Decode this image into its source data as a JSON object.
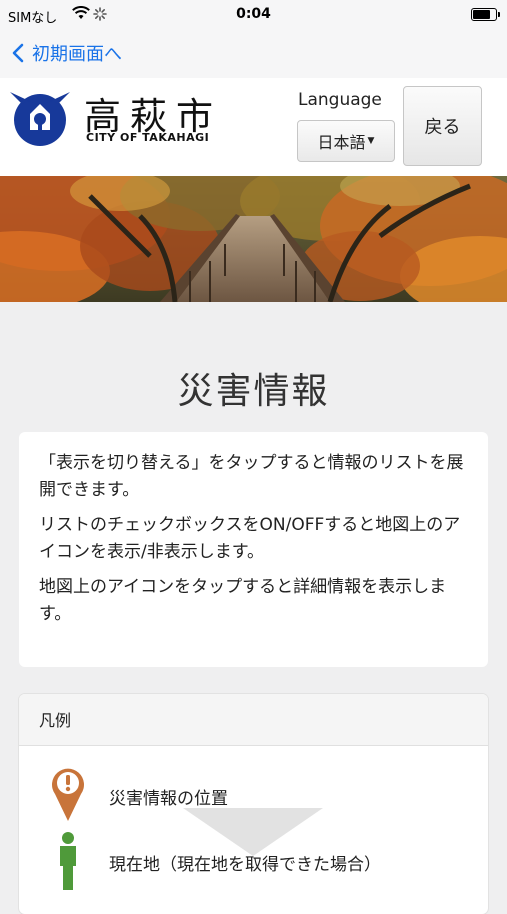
{
  "status_bar": {
    "carrier": "SIMなし",
    "time": "0:04"
  },
  "nav": {
    "back_label": "初期画面へ"
  },
  "header": {
    "logo_jp": "高萩市",
    "logo_en": "CITY OF TAKAHAGI",
    "language_label": "Language",
    "language_value": "日本語",
    "return_label": "戻る"
  },
  "main": {
    "title": "災害情報",
    "instructions": [
      "「表示を切り替える」をタップすると情報のリストを展開できます。",
      "リストのチェックボックスをON/OFFすると地図上のアイコンを表示/非表示します。",
      "地図上のアイコンをタップすると詳細情報を表示します。"
    ]
  },
  "legend": {
    "title": "凡例",
    "items": [
      {
        "icon": "map-pin-warning-icon",
        "color": "#c8743a",
        "label": "災害情報の位置"
      },
      {
        "icon": "person-icon",
        "color": "#4f9a3a",
        "label": "現在地（現在地を取得できた場合）"
      }
    ]
  },
  "colors": {
    "link": "#1a73e8",
    "emblem": "#17399a"
  }
}
